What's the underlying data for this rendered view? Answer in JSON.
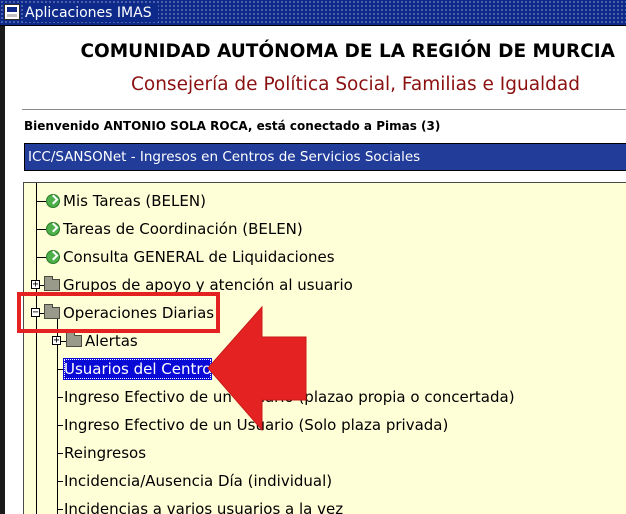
{
  "window": {
    "title": "Aplicaciones IMAS"
  },
  "header": {
    "title": "COMUNIDAD AUTÓNOMA DE LA REGIÓN DE MURCIA",
    "subtitle": "Consejería de Política Social, Familias e Igualdad"
  },
  "welcome_text": "Bienvenido ANTONIO SOLA ROCA, está conectado a Pimas (3)",
  "app_selector": {
    "value": "ICC/SANSONet - Ingresos en Centros de Servicios Sociales"
  },
  "tree": {
    "items": [
      {
        "label": "Mis Tareas (BELEN)",
        "icon": "task-arrow-icon"
      },
      {
        "label": "Tareas de Coordinación (BELEN)",
        "icon": "task-arrow-icon"
      },
      {
        "label": "Consulta GENERAL de Liquidaciones",
        "icon": "task-arrow-icon"
      },
      {
        "label": "Grupos de apoyo y atención al usuario",
        "icon": "folder-icon",
        "state": "collapsed"
      },
      {
        "label": "Operaciones Diarias",
        "icon": "folder-icon",
        "state": "expanded"
      },
      {
        "label": "Alertas",
        "icon": "folder-icon",
        "state": "collapsed"
      },
      {
        "label": "Usuarios del Centro",
        "selected": true
      },
      {
        "label": "Ingreso Efectivo de un Usuario (plazao propia o concertada)"
      },
      {
        "label": "Ingreso Efectivo de un Usuario (Solo plaza privada)"
      },
      {
        "label": "Reingresos"
      },
      {
        "label": "Incidencia/Ausencia Día (individual)"
      },
      {
        "label": "Incidencias a varios usuarios a la vez"
      }
    ]
  },
  "colors": {
    "title_bar": "#0d2a8a",
    "subtitle": "#8b1010",
    "selector_bg": "#223c9a",
    "tree_bg": "#ffffd7",
    "selection": "#0a0ad6",
    "callout": "#e52222"
  }
}
